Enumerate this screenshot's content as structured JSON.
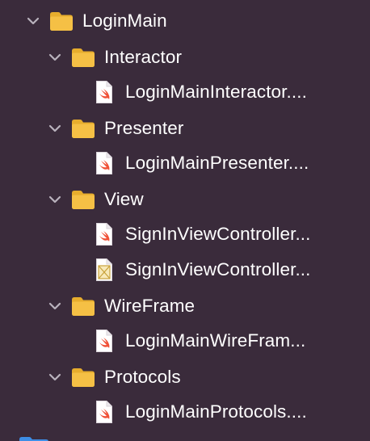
{
  "colors": {
    "background": "#3a2b3b",
    "folder": "#f5c045",
    "folder_tab": "#e7ad2d",
    "swift": "#f05138",
    "text": "#ffffff",
    "chevron": "#b9b2bd"
  },
  "tree": [
    {
      "kind": "folder",
      "level": 0,
      "label": "LoginMain",
      "icon": "folder-icon",
      "expanded": true
    },
    {
      "kind": "folder",
      "level": 1,
      "label": "Interactor",
      "icon": "folder-icon",
      "expanded": true
    },
    {
      "kind": "file",
      "level": 2,
      "label": "LoginMainInteractor....",
      "icon": "swift-file-icon"
    },
    {
      "kind": "folder",
      "level": 1,
      "label": "Presenter",
      "icon": "folder-icon",
      "expanded": true
    },
    {
      "kind": "file",
      "level": 2,
      "label": "LoginMainPresenter....",
      "icon": "swift-file-icon"
    },
    {
      "kind": "folder",
      "level": 1,
      "label": "View",
      "icon": "folder-icon",
      "expanded": true
    },
    {
      "kind": "file",
      "level": 2,
      "label": "SignInViewController...",
      "icon": "swift-file-icon"
    },
    {
      "kind": "file",
      "level": 2,
      "label": "SignInViewController...",
      "icon": "xib-file-icon"
    },
    {
      "kind": "folder",
      "level": 1,
      "label": "WireFrame",
      "icon": "folder-icon",
      "expanded": true
    },
    {
      "kind": "file",
      "level": 2,
      "label": "LoginMainWireFram...",
      "icon": "swift-file-icon"
    },
    {
      "kind": "folder",
      "level": 1,
      "label": "Protocols",
      "icon": "folder-icon",
      "expanded": true
    },
    {
      "kind": "file",
      "level": 2,
      "label": "LoginMainProtocols....",
      "icon": "swift-file-icon"
    }
  ]
}
